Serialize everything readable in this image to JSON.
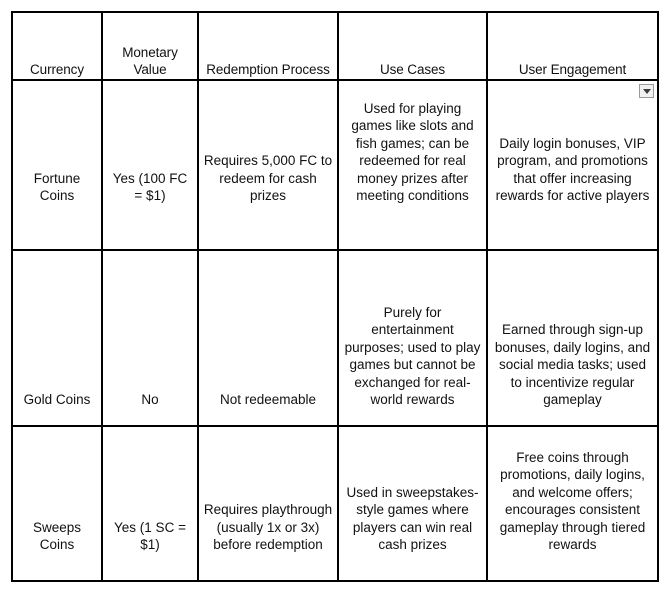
{
  "table": {
    "name": "currency-comparison-table",
    "columns": [
      "Currency",
      "Monetary Value",
      "Redemption Process",
      "Use Cases",
      "User Engagement"
    ],
    "headers": {
      "currency": "Currency",
      "monetary_value": "Monetary Value",
      "redemption_process": "Redemption Process",
      "use_cases": "Use Cases",
      "user_engagement": "User Engagement"
    },
    "rows": [
      {
        "currency": "Fortune Coins",
        "monetary_value": "Yes (100 FC = $1)",
        "redemption_process": "Requires 5,000 FC to redeem for cash prizes",
        "use_cases": "Used for playing games like slots and fish games; can be redeemed for real money prizes after meeting conditions",
        "user_engagement": "Daily login bonuses, VIP program, and promotions that offer increasing rewards for active players"
      },
      {
        "currency": "Gold Coins",
        "monetary_value": "No",
        "redemption_process": "Not redeemable",
        "use_cases": "Purely for entertainment purposes; used to play games but cannot be exchanged for real-world rewards",
        "user_engagement": "Earned through sign-up bonuses, daily logins, and social media tasks; used to incentivize regular gameplay"
      },
      {
        "currency": "Sweeps Coins",
        "monetary_value": "Yes (1 SC = $1)",
        "redemption_process": "Requires playthrough (usually 1x or 3x) before redemption",
        "use_cases": "Used in sweepstakes-style games where players can win real cash prizes",
        "user_engagement": "Free coins through promotions, daily logins, and welcome offers; encourages consistent gameplay through tiered rewards"
      }
    ]
  },
  "controls": {
    "spinner": {
      "icon": "chevron-down-icon",
      "label": ""
    }
  },
  "colors": {
    "border": "#000000",
    "text": "#111111",
    "background": "#ffffff",
    "control_face": "#f1f1f1",
    "control_border": "#9a9a9a",
    "caret": "#3c3c3c"
  }
}
